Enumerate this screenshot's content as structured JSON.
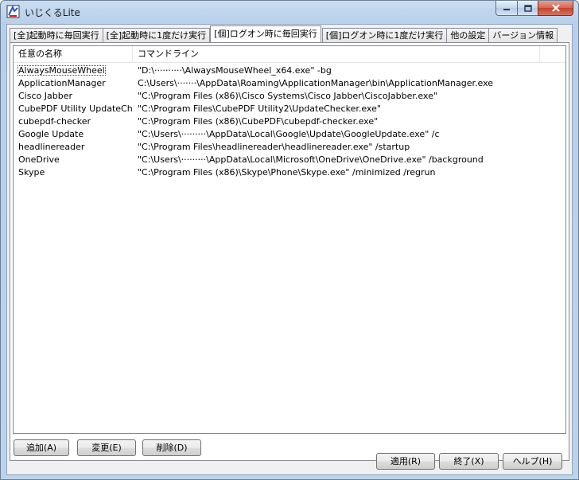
{
  "window": {
    "title": "いじくるLite"
  },
  "tabs": [
    {
      "label": "[全]起動時に毎回実行",
      "active": false
    },
    {
      "label": "[全]起動時に1度だけ実行",
      "active": false
    },
    {
      "label": "[個]ログオン時に毎回実行",
      "active": true
    },
    {
      "label": "[個]ログオン時に1度だけ実行",
      "active": false
    },
    {
      "label": "他の設定",
      "active": false
    },
    {
      "label": "バージョン情報",
      "active": false
    }
  ],
  "list": {
    "columns": [
      "任意の名称",
      "コマンドライン"
    ],
    "rows": [
      {
        "name": "AlwaysMouseWheel",
        "command": "\"D:\\··········\\AlwaysMouseWheel_x64.exe\" -bg"
      },
      {
        "name": "ApplicationManager",
        "command": "C:\\Users\\·······\\AppData\\Roaming\\ApplicationManager\\bin\\ApplicationManager.exe"
      },
      {
        "name": "Cisco Jabber",
        "command": "\"C:\\Program Files (x86)\\Cisco Systems\\Cisco Jabber\\CiscoJabber.exe\""
      },
      {
        "name": "CubePDF Utility UpdateCh...",
        "command": "\"C:\\Program Files\\CubePDF Utility2\\UpdateChecker.exe\""
      },
      {
        "name": "cubepdf-checker",
        "command": "\"C:\\Program Files (x86)\\CubePDF\\cubepdf-checker.exe\""
      },
      {
        "name": "Google Update",
        "command": "\"C:\\Users\\·········\\AppData\\Local\\Google\\Update\\GoogleUpdate.exe\" /c"
      },
      {
        "name": "headlinereader",
        "command": "\"C:\\Program Files\\headlinereader\\headlinereader.exe\" /startup"
      },
      {
        "name": "OneDrive",
        "command": "\"C:\\Users\\·········\\AppData\\Local\\Microsoft\\OneDrive\\OneDrive.exe\" /background"
      },
      {
        "name": "Skype",
        "command": "\"C:\\Program Files (x86)\\Skype\\Phone\\Skype.exe\" /minimized /regrun"
      }
    ]
  },
  "buttons": {
    "add": "追加(A)",
    "edit": "変更(E)",
    "delete": "削除(D)",
    "apply": "適用(R)",
    "exit": "終了(X)",
    "help": "ヘルプ(H)"
  }
}
